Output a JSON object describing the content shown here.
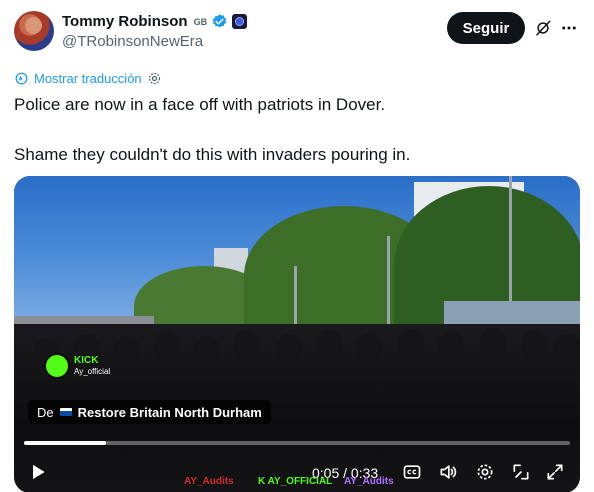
{
  "author": {
    "display_name": "Tommy Robinson",
    "country_code": "GB",
    "handle": "@TRobinsonNewEra"
  },
  "header": {
    "follow_label": "Seguir"
  },
  "tweet": {
    "translate_label": "Mostrar traducción",
    "line1": "Police are now in a face off with patriots in Dover.",
    "line2": "Shame they couldn't do this with invaders pouring in."
  },
  "video": {
    "kick_brand": "KICK",
    "kick_user": "Ay_official",
    "source_prefix": "De",
    "source_name": "Restore Britain North Durham",
    "time": "0:05 / 0:33",
    "progress": 0.15,
    "watermarks": [
      "AY_Audits",
      "K AY_OFFICIAL",
      "AY_Audits"
    ]
  },
  "colors": {
    "accent": "#1d9bf0",
    "text": "#0f1419",
    "muted": "#536471",
    "verified": "#1d9bf0",
    "kick_green": "#53fc18"
  },
  "icons": [
    "verified-badge-icon",
    "affiliate-badge-icon",
    "grok-icon",
    "more-icon",
    "translate-settings-icon",
    "play-icon",
    "captions-icon",
    "volume-icon",
    "settings-icon",
    "pip-icon",
    "fullscreen-icon"
  ]
}
